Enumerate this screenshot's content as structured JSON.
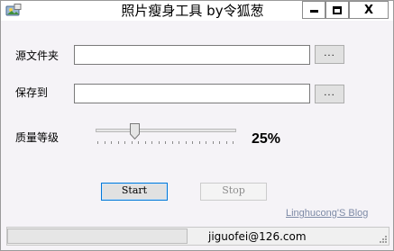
{
  "window": {
    "title": "照片瘦身工具 by令狐葱",
    "controls": {
      "minimize_icon": "minimize-icon",
      "maximize_icon": "maximize-icon",
      "close_glyph": "X"
    },
    "app_icon": "photo-app-icon"
  },
  "form": {
    "source_label": "源文件夹",
    "source_value": "",
    "source_browse": "...",
    "save_label": "保存到",
    "save_value": "",
    "save_browse": "...",
    "quality_label": "质量等级",
    "quality_percent_text": "25%",
    "quality_fraction": 0.25
  },
  "actions": {
    "start_label": "Start",
    "stop_label": "Stop",
    "stop_enabled": false
  },
  "footer": {
    "blog_link": "Linghucong'S Blog",
    "email": "jiguofei@126.com",
    "progress_fraction": 0.0
  },
  "colors": {
    "accent_focus": "#0078d7",
    "progress_fill": "#06b025",
    "link": "#7d8aa6"
  }
}
